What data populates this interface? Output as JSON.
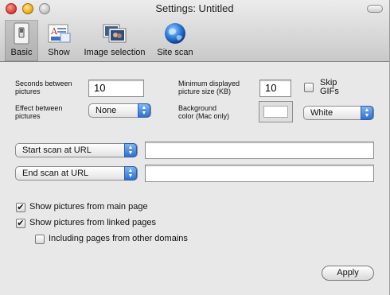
{
  "window": {
    "title": "Settings: Untitled"
  },
  "toolbar": {
    "items": [
      {
        "label": "Basic",
        "icon": "switch-icon"
      },
      {
        "label": "Show",
        "icon": "slideshow-icon"
      },
      {
        "label": "Image selection",
        "icon": "photos-icon"
      },
      {
        "label": "Site scan",
        "icon": "globe-icon"
      }
    ]
  },
  "basic": {
    "seconds_label_1": "Seconds between",
    "seconds_label_2": "pictures",
    "seconds_value": "10",
    "effect_label_1": "Effect between",
    "effect_label_2": "pictures",
    "effect_value": "None",
    "min_size_label_1": "Minimum displayed",
    "min_size_label_2": "picture size (KB)",
    "min_size_value": "10",
    "skip_gifs_label_1": "Skip",
    "skip_gifs_label_2": "GIFs",
    "skip_gifs_checked": false,
    "background_label_1": "Background",
    "background_label_2": "color (Mac only)",
    "background_color": "#ffffff",
    "background_value": "White"
  },
  "scan": {
    "start_option": "Start scan at URL",
    "start_url": "",
    "end_option": "End scan at URL",
    "end_url": ""
  },
  "options": {
    "show_main": {
      "label": "Show pictures from main page",
      "checked": true
    },
    "show_linked": {
      "label": "Show pictures from linked pages",
      "checked": true
    },
    "other_domains": {
      "label": "Including pages from other domains",
      "checked": false
    }
  },
  "apply_label": "Apply",
  "colors": {
    "popup_arrow": "#2f6fd4",
    "window_bg": "#e8e8e8"
  }
}
